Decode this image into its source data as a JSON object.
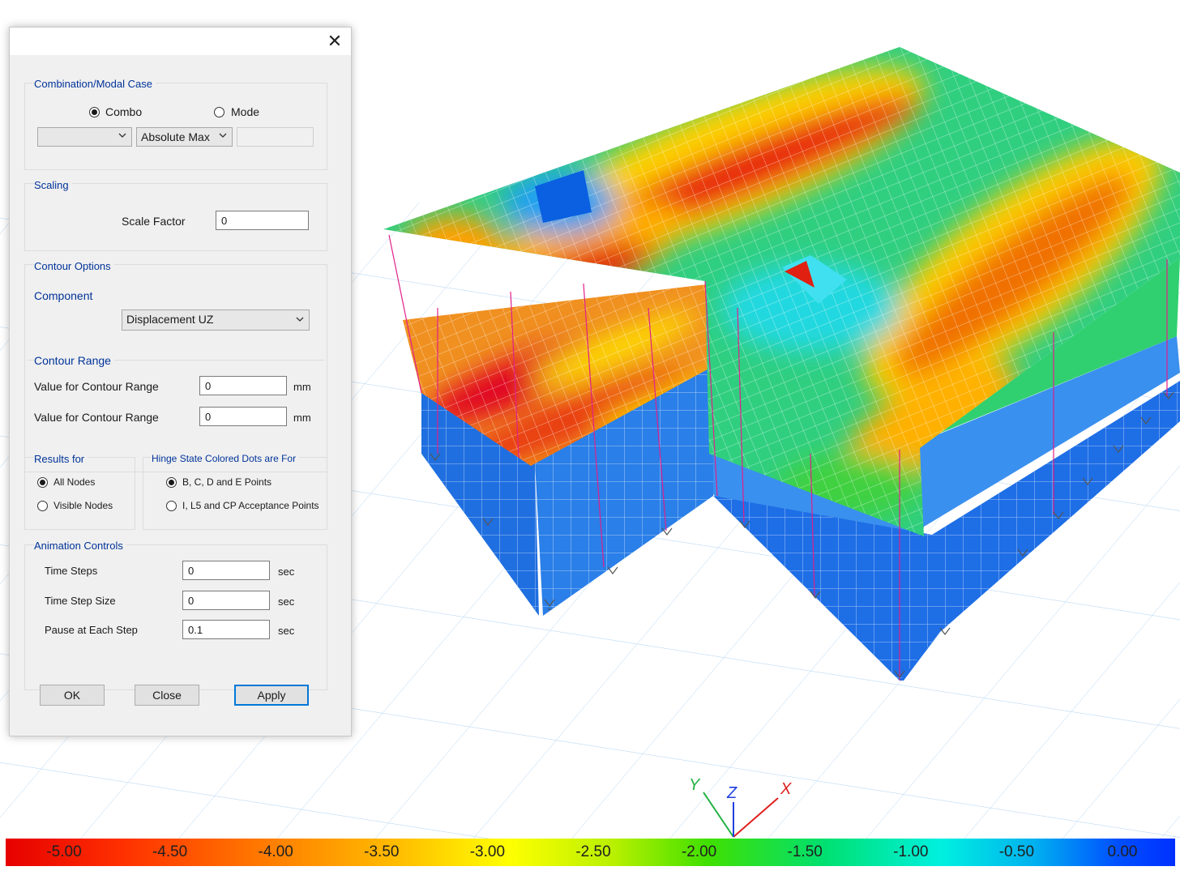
{
  "dialog": {
    "close_icon": "close-icon",
    "combination": {
      "legend": "Combination/Modal Case",
      "combo_label": "Combo",
      "mode_label": "Mode",
      "selected": "combo",
      "case_value": "",
      "envelope_value": "Absolute Max",
      "mode_value": ""
    },
    "scaling": {
      "legend": "Scaling",
      "scale_factor_label": "Scale Factor",
      "scale_factor_value": "0"
    },
    "contour_options": {
      "legend": "Contour Options",
      "component_label": "Component",
      "component_value": "Displacement UZ",
      "range_legend": "Contour Range",
      "min_label": "Value for Contour Range",
      "min_value": "0",
      "min_unit": "mm",
      "max_label": "Value for Contour Range",
      "max_value": "0",
      "max_unit": "mm"
    },
    "results_for": {
      "legend": "Results for",
      "all_nodes": "All Nodes",
      "visible_nodes": "Visible Nodes",
      "selected": "all"
    },
    "hinge_state": {
      "legend": "Hinge State Colored Dots are For",
      "option1": "B, C, D and E Points",
      "option2": "I, L5 and CP Acceptance Points",
      "selected": "option1"
    },
    "animation": {
      "legend": "Animation Controls",
      "time_steps_label": "Time Steps",
      "time_steps_value": "0",
      "time_steps_unit": "sec",
      "time_step_size_label": "Time Step Size",
      "time_step_size_value": "0",
      "time_step_size_unit": "sec",
      "pause_label": "Pause at Each Step",
      "pause_value": "0.1",
      "pause_unit": "sec"
    },
    "buttons": {
      "ok": "OK",
      "close": "Close",
      "apply": "Apply"
    }
  },
  "axes": {
    "x": "X",
    "y": "Y",
    "z": "Z",
    "x_color": "#e02020",
    "y_color": "#20b040",
    "z_color": "#2040e0"
  },
  "colorbar": {
    "labels": [
      "-5.00",
      "-4.50",
      "-4.00",
      "-3.50",
      "-3.00",
      "-2.50",
      "-2.00",
      "-1.50",
      "-1.00",
      "-0.50",
      "0.00"
    ]
  }
}
